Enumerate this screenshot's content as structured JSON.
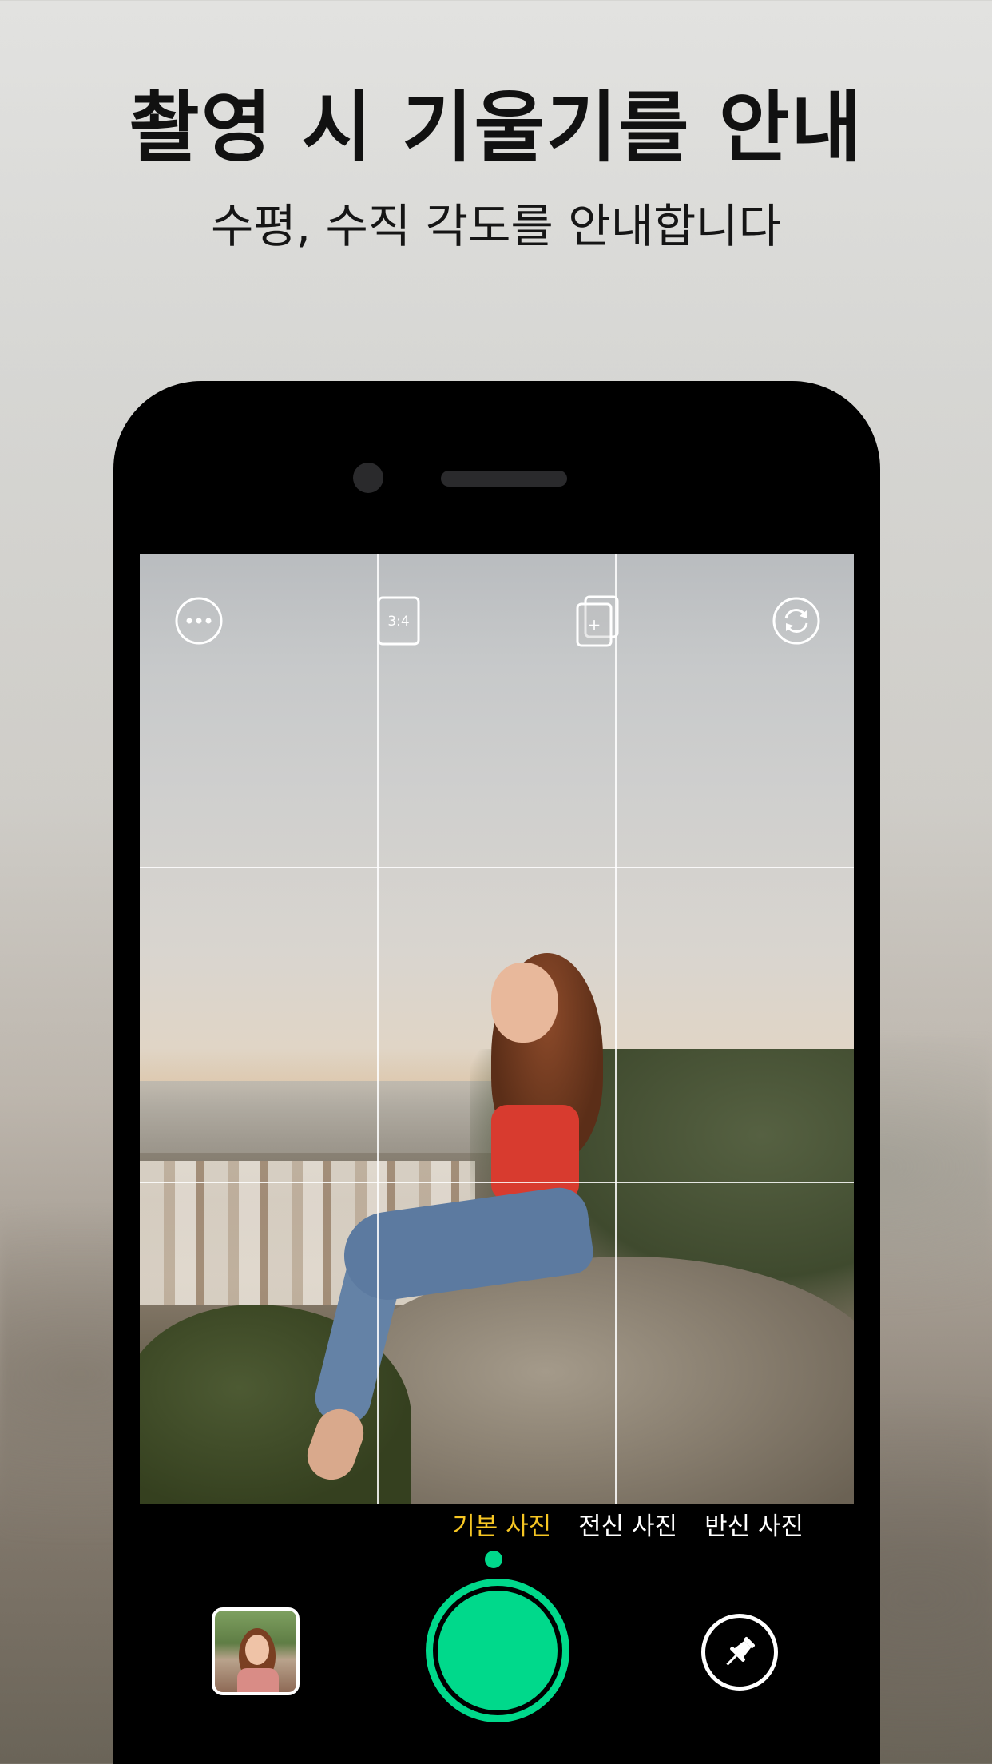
{
  "headline": "촬영 시 기울기를 안내",
  "subheadline": "수평, 수직 각도를 안내합니다",
  "camera": {
    "top_icons": [
      {
        "name": "more-icon"
      },
      {
        "name": "aspect-ratio-icon",
        "label": "3:4"
      },
      {
        "name": "add-frame-icon",
        "label": "+"
      },
      {
        "name": "switch-camera-icon"
      }
    ],
    "modes": [
      {
        "label": "기본 사진",
        "active": true
      },
      {
        "label": "전신 사진",
        "active": false
      },
      {
        "label": "반신 사진",
        "active": false
      }
    ],
    "accent_color": "#00d98b",
    "active_mode_color": "#f6c623"
  },
  "controls": {
    "gallery_thumbnail": "gallery-thumbnail",
    "shutter": "shutter-button",
    "pin": "pin-icon"
  }
}
